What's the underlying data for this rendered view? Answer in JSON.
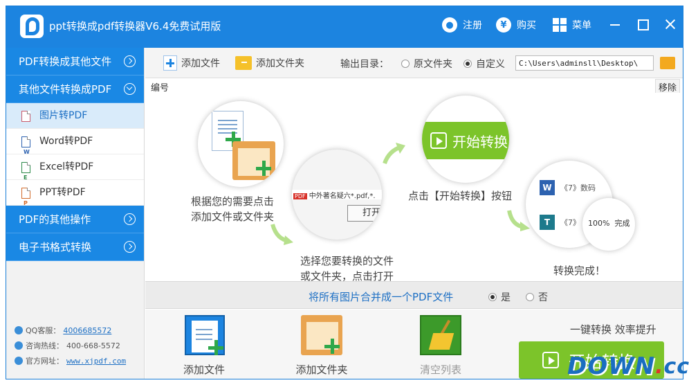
{
  "app": {
    "title": "ppt转换成pdf转换器V6.4免费试用版"
  },
  "titlebar": {
    "register": "注册",
    "buy": "购买",
    "menu": "菜单",
    "buy_symbol": "¥"
  },
  "sidebar": {
    "sections": [
      {
        "label": "PDF转换成其他文件"
      },
      {
        "label": "其他文件转换成PDF"
      },
      {
        "label": "PDF的其他操作"
      },
      {
        "label": "电子书格式转换"
      }
    ],
    "items": [
      {
        "label": "图片转PDF"
      },
      {
        "label": "Word转PDF",
        "glyph": "W"
      },
      {
        "label": "Excel转PDF",
        "glyph": "E"
      },
      {
        "label": "PPT转PDF",
        "glyph": "P"
      }
    ],
    "contact": {
      "qq_label": "QQ客服：",
      "qq": "4006685572",
      "phone_label": "咨询热线：",
      "phone": "400-668-5572",
      "site_label": "官方网址：",
      "site": "www.xjpdf.com"
    }
  },
  "toolbar": {
    "add_file": "添加文件",
    "add_folder": "添加文件夹",
    "output_label": "输出目录：",
    "option_original": "原文件夹",
    "option_custom": "自定义",
    "output_path": "C:\\Users\\adminsll\\Desktop\\"
  },
  "list": {
    "col_number": "编号",
    "remove": "移除"
  },
  "guide": {
    "step1": [
      "根据您的需要点击",
      "添加文件或文件夹"
    ],
    "step2": [
      "选择您要转换的文件",
      "或文件夹，点击打开"
    ],
    "step3": "点击【开始转换】按钮",
    "step4": "转换完成！",
    "bubble2_filename": "中外著名疑六*.pdf,*.",
    "bubble2_open": "打开",
    "bubble2_pdf_tag": "PDF",
    "bubble3_start": "开始转换",
    "bubble4_row1": "《7》数码",
    "bubble4_row2": "《7》",
    "bubble4_percent": "100%",
    "bubble4_done": "完成",
    "bubble4_w": "W",
    "bubble4_t": "T"
  },
  "merge": {
    "text": "将所有图片合并成一个PDF文件",
    "yes": "是",
    "no": "否"
  },
  "bottom": {
    "add_file": "添加文件",
    "add_folder": "添加文件夹",
    "clear_list": "清空列表",
    "slogan": "一键转换  效率提升",
    "start": "开始转换"
  },
  "watermark": {
    "part1": "DOWN",
    "part2": ".",
    "part3": "cc"
  }
}
